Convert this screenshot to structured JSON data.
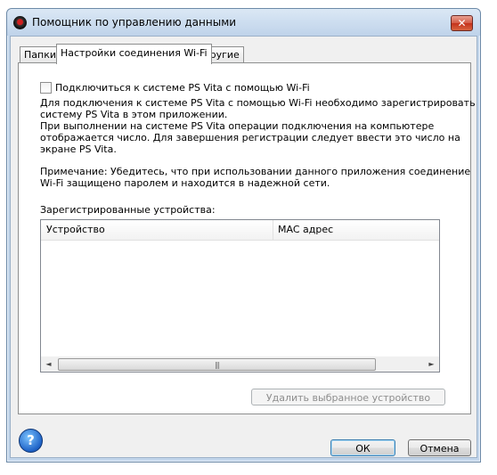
{
  "window": {
    "title": "Помощник по управлению данными",
    "close_glyph": "✕"
  },
  "tabs": [
    {
      "label": "Папки",
      "active": false
    },
    {
      "label": "Настройки соединения Wi-Fi",
      "active": true
    },
    {
      "label": "Другие",
      "active": false
    }
  ],
  "wifi": {
    "checkbox_label": "Подключиться к системе PS Vita с помощью Wi-Fi",
    "checkbox_checked": false,
    "desc_line1": "Для подключения к системе PS Vita с помощью Wi-Fi необходимо зарегистрировать",
    "desc_line2": "систему PS Vita в этом приложении.",
    "desc_line3": "При выполнении на системе PS Vita операции подключения на компьютере",
    "desc_line4": "отображается число. Для завершения регистрации следует ввести это число на",
    "desc_line5": "экране PS Vita.",
    "note_line1": "Примечание: Убедитесь, что при использовании данного приложения соединение",
    "note_line2": "Wi-Fi защищено паролем и находится в надежной сети.",
    "registered_label": "Зарегистрированные устройства:",
    "columns": [
      "Устройство",
      "MAC адрес"
    ],
    "rows": [],
    "remove_button": "Удалить выбранное устройство",
    "scroll_grip": "|||"
  },
  "footer": {
    "help_glyph": "?",
    "ok": "ОК",
    "cancel": "Отмена"
  },
  "icons": [
    "app-icon",
    "close-icon",
    "help-icon",
    "scroll-left-icon",
    "scroll-right-icon"
  ]
}
